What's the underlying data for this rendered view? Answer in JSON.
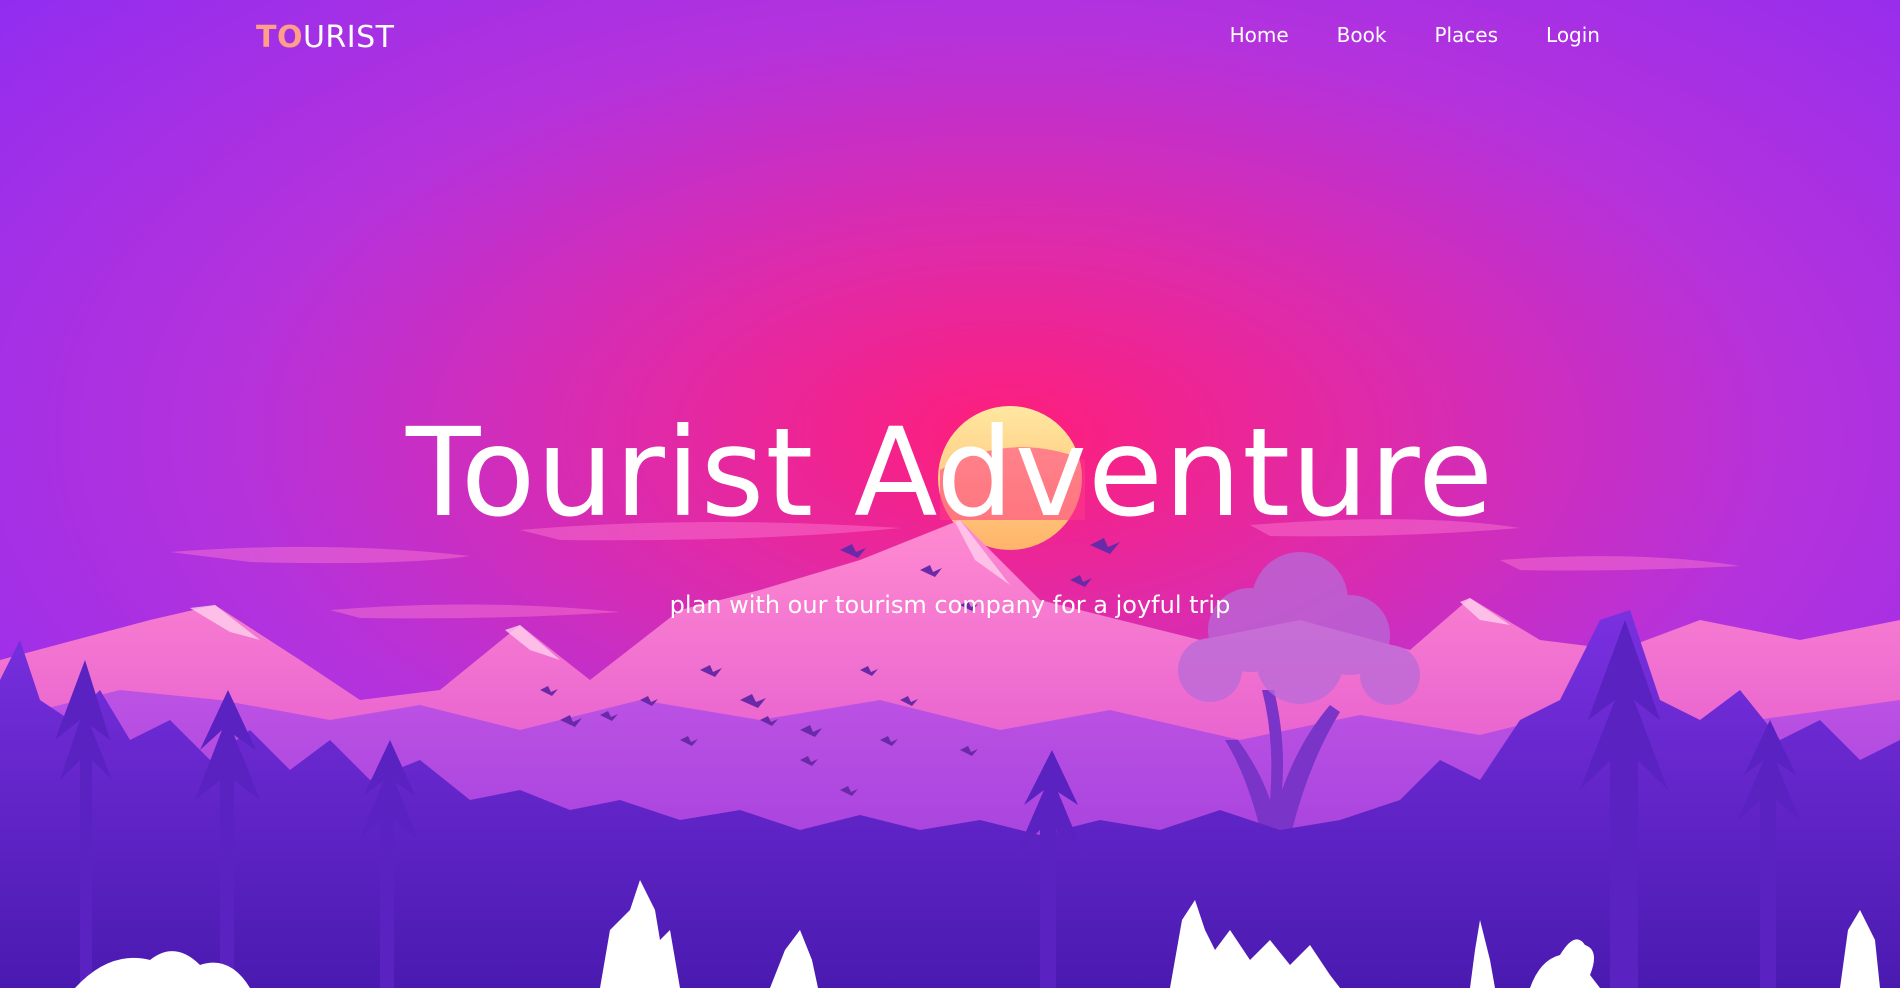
{
  "brand": {
    "accent_part": "TO",
    "rest_part": "URIST"
  },
  "nav": {
    "links": [
      {
        "label": "Home"
      },
      {
        "label": "Book"
      },
      {
        "label": "Places"
      },
      {
        "label": "Login"
      }
    ]
  },
  "hero": {
    "title": "Tourist Adventure",
    "subtitle": "plan with our tourism company for a joyful trip"
  },
  "colors": {
    "sky_top": "#8a2cf0",
    "sky_glow": "#ff2a8a",
    "sun": "#ffd98a",
    "logo_accent": "#ff9f8a",
    "text": "#ffffff"
  }
}
